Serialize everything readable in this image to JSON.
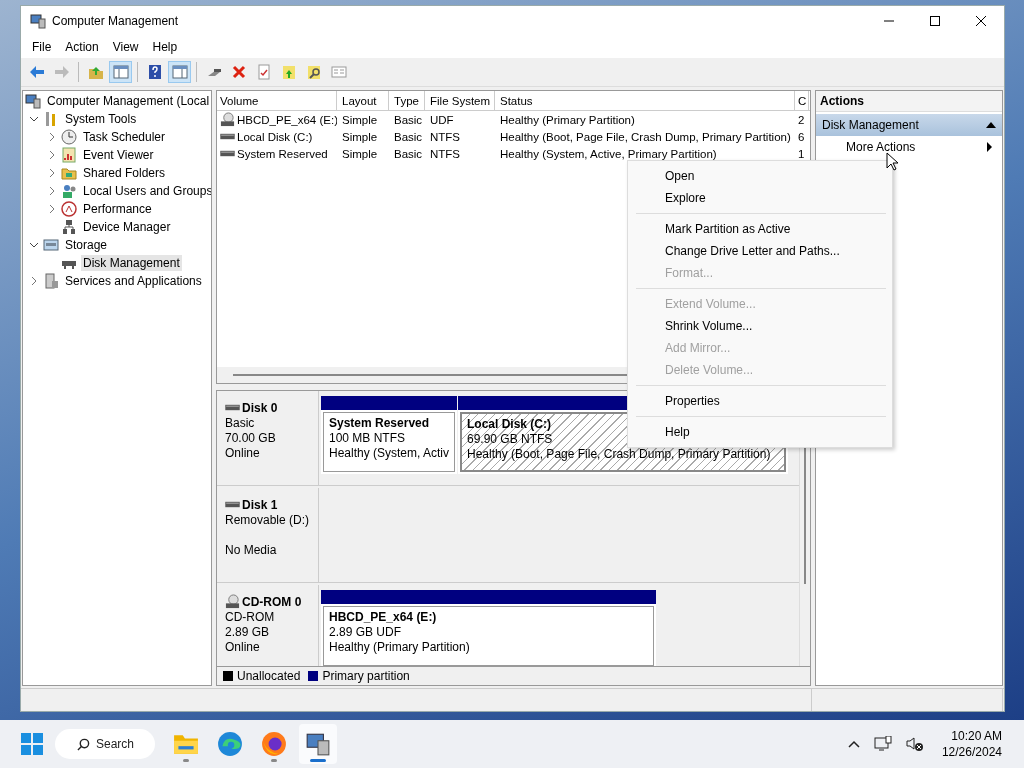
{
  "window": {
    "title": "Computer Management"
  },
  "menu": [
    "File",
    "Action",
    "View",
    "Help"
  ],
  "toolbar": [
    {
      "kind": "back",
      "disabled": false,
      "pressed": false
    },
    {
      "kind": "forward",
      "disabled": true,
      "pressed": false
    },
    {
      "kind": "separator"
    },
    {
      "kind": "up-folder",
      "disabled": false,
      "pressed": false
    },
    {
      "kind": "tree",
      "disabled": false,
      "pressed": true
    },
    {
      "kind": "separator"
    },
    {
      "kind": "help",
      "disabled": false,
      "pressed": false
    },
    {
      "kind": "pane",
      "disabled": false,
      "pressed": true
    },
    {
      "kind": "separator"
    },
    {
      "kind": "connect",
      "disabled": false,
      "pressed": false
    },
    {
      "kind": "delete",
      "disabled": false,
      "pressed": false
    },
    {
      "kind": "check",
      "disabled": false,
      "pressed": false
    },
    {
      "kind": "folder-arrow",
      "disabled": false,
      "pressed": false
    },
    {
      "kind": "folder-search",
      "disabled": false,
      "pressed": false
    },
    {
      "kind": "list",
      "disabled": false,
      "pressed": false
    }
  ],
  "tree": {
    "label": "Computer Management (Local",
    "kind": "computer",
    "selected": false,
    "children": [
      {
        "label": "System Tools",
        "kind": "tools",
        "expanded": true,
        "selected": false,
        "children": [
          {
            "label": "Task Scheduler",
            "kind": "clock",
            "expanded": false,
            "selected": false
          },
          {
            "label": "Event Viewer",
            "kind": "event",
            "expanded": false,
            "selected": false
          },
          {
            "label": "Shared Folders",
            "kind": "share",
            "expanded": false,
            "selected": false
          },
          {
            "label": "Local Users and Groups",
            "kind": "users",
            "expanded": false,
            "selected": false
          },
          {
            "label": "Performance",
            "kind": "perf",
            "expanded": false,
            "selected": false
          },
          {
            "label": "Device Manager",
            "kind": "device",
            "selected": false
          }
        ]
      },
      {
        "label": "Storage",
        "kind": "storage",
        "expanded": true,
        "selected": false,
        "children": [
          {
            "label": "Disk Management",
            "kind": "disk",
            "selected": true
          }
        ]
      },
      {
        "label": "Services and Applications",
        "kind": "services",
        "expanded": false,
        "selected": false
      }
    ]
  },
  "volumes": {
    "columns": [
      "Volume",
      "Layout",
      "Type",
      "File System",
      "Status",
      "C"
    ],
    "rows": [
      {
        "kind": "cdrom",
        "cells": [
          "HBCD_PE_x64 (E:)",
          "Simple",
          "Basic",
          "UDF",
          "Healthy (Primary Partition)",
          "2"
        ]
      },
      {
        "kind": "disk",
        "cells": [
          "Local Disk (C:)",
          "Simple",
          "Basic",
          "NTFS",
          "Healthy (Boot, Page File, Crash Dump, Primary Partition)",
          "6"
        ]
      },
      {
        "kind": "disk",
        "cells": [
          "System Reserved",
          "Simple",
          "Basic",
          "NTFS",
          "Healthy (System, Active, Primary Partition)",
          "1"
        ]
      }
    ]
  },
  "disks": [
    {
      "kind": "disk",
      "name": "Disk 0",
      "type": "Basic",
      "size": "70.00 GB",
      "status": "Online",
      "partitions": [
        {
          "name": "System Reserved",
          "detail": "100 MB NTFS",
          "status": "Healthy (System, Activ",
          "selected": false
        },
        {
          "name": "Local Disk  (C:)",
          "detail": "69.90 GB NTFS",
          "status": "Healthy (Boot, Page File, Crash Dump, Primary Partition)",
          "selected": true
        }
      ]
    },
    {
      "kind": "disk",
      "name": "Disk 1",
      "type": "Removable (D:)",
      "status": "No Media"
    },
    {
      "kind": "cdrom",
      "name": "CD-ROM 0",
      "type": "CD-ROM",
      "size": "2.89 GB",
      "status": "Online",
      "partitions": [
        {
          "name": "HBCD_PE_x64  (E:)",
          "detail": "2.89 GB UDF",
          "status": "Healthy (Primary Partition)",
          "selected": false
        }
      ]
    }
  ],
  "legend": [
    {
      "label": "Unallocated",
      "color": "#000000"
    },
    {
      "label": "Primary partition",
      "color": "#000080"
    }
  ],
  "actions": {
    "title": "Actions",
    "section": {
      "label": "Disk Management",
      "expanded": true
    },
    "items": [
      {
        "label": "More Actions",
        "submenu": true
      }
    ]
  },
  "context_menu": [
    {
      "kind": "item",
      "label": "Open",
      "disabled": false
    },
    {
      "kind": "item",
      "label": "Explore",
      "disabled": false
    },
    {
      "kind": "separator"
    },
    {
      "kind": "item",
      "label": "Mark Partition as Active",
      "disabled": false
    },
    {
      "kind": "item",
      "label": "Change Drive Letter and Paths...",
      "disabled": false
    },
    {
      "kind": "item",
      "label": "Format...",
      "disabled": true
    },
    {
      "kind": "separator"
    },
    {
      "kind": "item",
      "label": "Extend Volume...",
      "disabled": true
    },
    {
      "kind": "item",
      "label": "Shrink Volume...",
      "disabled": false
    },
    {
      "kind": "item",
      "label": "Add Mirror...",
      "disabled": true
    },
    {
      "kind": "item",
      "label": "Delete Volume...",
      "disabled": true
    },
    {
      "kind": "separator"
    },
    {
      "kind": "item",
      "label": "Properties",
      "disabled": false
    },
    {
      "kind": "separator"
    },
    {
      "kind": "item",
      "label": "Help",
      "disabled": false
    }
  ],
  "taskbar": {
    "search": {
      "placeholder": "Search"
    },
    "apps": [
      {
        "kind": "folder",
        "running": true,
        "active": false
      },
      {
        "kind": "edge",
        "running": false,
        "active": false
      },
      {
        "kind": "firefox",
        "running": true,
        "active": false
      },
      {
        "kind": "computer",
        "running": true,
        "active": true
      }
    ],
    "time": "10:20 AM",
    "date": "12/26/2024"
  }
}
